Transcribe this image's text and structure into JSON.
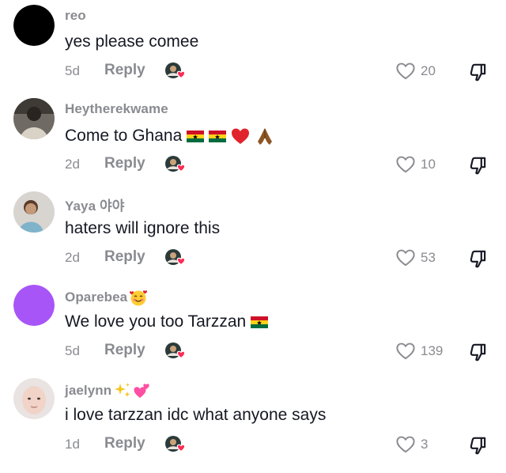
{
  "reply_label": "Reply",
  "comments": [
    {
      "username": "reo",
      "text": "yes please comee",
      "age": "5d",
      "likes": "20",
      "avatar": "black-circle-avatar",
      "text_emojis": []
    },
    {
      "username": "Heytherekwame",
      "text": "Come to Ghana",
      "age": "2d",
      "likes": "10",
      "avatar": "photo-avatar",
      "text_emojis": [
        "ghana-flag",
        "ghana-flag",
        "red-heart",
        "folded-hands"
      ]
    },
    {
      "username": "Yaya 야야",
      "text": "haters will ignore this",
      "age": "2d",
      "likes": "53",
      "avatar": "photo-avatar",
      "text_emojis": []
    },
    {
      "username": "Oparebea",
      "username_emojis": [
        "smiling-face-with-hearts"
      ],
      "text": "We love you too Tarzzan",
      "age": "5d",
      "likes": "139",
      "avatar": "purple-circle-avatar",
      "text_emojis": [
        "ghana-flag"
      ]
    },
    {
      "username": "jaelynn",
      "username_emojis": [
        "sparkles",
        "two-hearts"
      ],
      "text": "i love tarzzan idc what anyone says",
      "age": "1d",
      "likes": "3",
      "avatar": "photo-avatar",
      "text_emojis": []
    }
  ],
  "colors": {
    "muted": "#8a8b91",
    "text": "#161823",
    "purple_avatar": "#a855f7",
    "heart": "#fe2c55"
  }
}
